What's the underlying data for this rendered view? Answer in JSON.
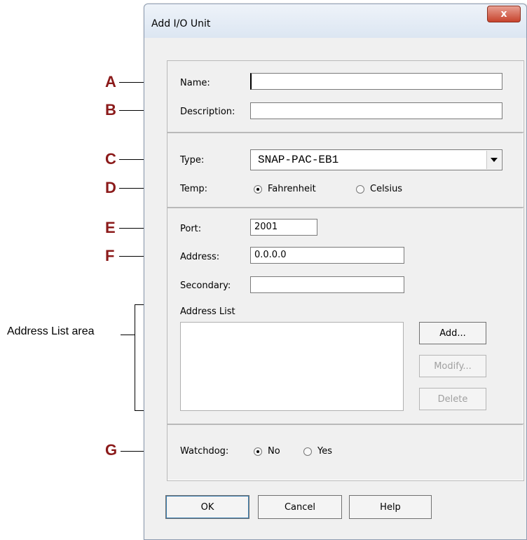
{
  "dialog": {
    "title": "Add I/O Unit",
    "close_glyph": "x"
  },
  "callouts": {
    "a": "A",
    "b": "B",
    "c": "C",
    "d": "D",
    "e": "E",
    "f": "F",
    "g": "G",
    "address_list_area": "Address List area"
  },
  "fields": {
    "name_label": "Name:",
    "name_value": "",
    "description_label": "Description:",
    "description_value": "",
    "type_label": "Type:",
    "type_value": "SNAP-PAC-EB1",
    "temp_label": "Temp:",
    "temp_fahrenheit": "Fahrenheit",
    "temp_celsius": "Celsius",
    "temp_selected": "Fahrenheit",
    "port_label": "Port:",
    "port_value": "2001",
    "address_label": "Address:",
    "address_value": "0.0.0.0",
    "secondary_label": "Secondary:",
    "secondary_value": "",
    "address_list_label": "Address List",
    "watchdog_label": "Watchdog:",
    "watchdog_no": "No",
    "watchdog_yes": "Yes",
    "watchdog_selected": "No"
  },
  "buttons": {
    "add": "Add...",
    "modify": "Modify...",
    "delete": "Delete",
    "ok": "OK",
    "cancel": "Cancel",
    "help": "Help"
  },
  "icons": {
    "close": "close-icon",
    "dropdown": "chevron-down-icon",
    "radio": "radio-icon"
  }
}
